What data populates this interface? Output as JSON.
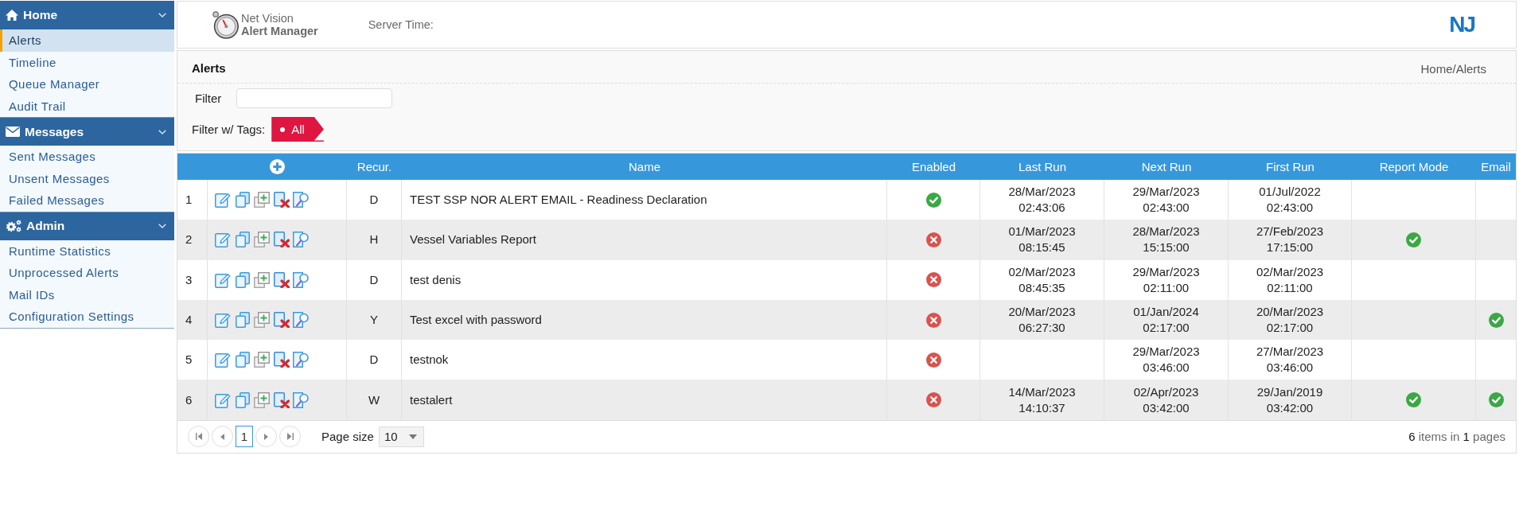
{
  "sidebar": {
    "sections": [
      {
        "title": "Home",
        "expanded": true,
        "items": [
          {
            "label": "Alerts",
            "selected": true
          },
          {
            "label": "Timeline",
            "selected": false
          },
          {
            "label": "Queue Manager",
            "selected": false
          },
          {
            "label": "Audit Trail",
            "selected": false
          }
        ]
      },
      {
        "title": "Messages",
        "expanded": true,
        "items": [
          {
            "label": "Sent Messages",
            "selected": false
          },
          {
            "label": "Unsent Messages",
            "selected": false
          },
          {
            "label": "Failed Messages",
            "selected": false
          }
        ]
      },
      {
        "title": "Admin",
        "expanded": true,
        "items": [
          {
            "label": "Runtime Statistics",
            "selected": false
          },
          {
            "label": "Unprocessed Alerts",
            "selected": false
          },
          {
            "label": "Mail IDs",
            "selected": false
          },
          {
            "label": "Configuration Settings",
            "selected": false
          }
        ]
      }
    ]
  },
  "header": {
    "app_name": "Net Vision",
    "app_subtitle": "Alert Manager",
    "server_time_label": "Server Time:",
    "brand_logo": "NJ"
  },
  "page": {
    "title": "Alerts",
    "breadcrumb": "Home/Alerts",
    "filter": {
      "label": "Filter"
    },
    "tag_filter": {
      "label": "Filter w/ Tags:",
      "tags": [
        {
          "label": "All",
          "selected": true
        }
      ]
    }
  },
  "table": {
    "columns": [
      "Recur.",
      "Name",
      "Enabled",
      "Last Run",
      "Next Run",
      "First Run",
      "Report Mode",
      "Email"
    ],
    "rows": [
      {
        "number": "1",
        "recurrence": "D",
        "name": "TEST SSP NOR ALERT EMAIL - Readiness Declaration",
        "enabled": true,
        "last_run": {
          "date": "28/Mar/2023",
          "time": "02:43:06"
        },
        "next_run": {
          "date": "29/Mar/2023",
          "time": "02:43:00"
        },
        "first_run": {
          "date": "01/Jul/2022",
          "time": "02:43:00"
        },
        "report_mode": false,
        "email": false
      },
      {
        "number": "2",
        "recurrence": "H",
        "name": "Vessel Variables Report",
        "enabled": false,
        "last_run": {
          "date": "01/Mar/2023",
          "time": "08:15:45"
        },
        "next_run": {
          "date": "28/Mar/2023",
          "time": "15:15:00"
        },
        "first_run": {
          "date": "27/Feb/2023",
          "time": "17:15:00"
        },
        "report_mode": true,
        "email": false
      },
      {
        "number": "3",
        "recurrence": "D",
        "name": "test denis",
        "enabled": false,
        "last_run": {
          "date": "02/Mar/2023",
          "time": "08:45:35"
        },
        "next_run": {
          "date": "29/Mar/2023",
          "time": "02:11:00"
        },
        "first_run": {
          "date": "02/Mar/2023",
          "time": "02:11:00"
        },
        "report_mode": false,
        "email": false
      },
      {
        "number": "4",
        "recurrence": "Y",
        "name": "Test excel with password",
        "enabled": false,
        "last_run": {
          "date": "20/Mar/2023",
          "time": "06:27:30"
        },
        "next_run": {
          "date": "01/Jan/2024",
          "time": "02:17:00"
        },
        "first_run": {
          "date": "20/Mar/2023",
          "time": "02:17:00"
        },
        "report_mode": false,
        "email": true
      },
      {
        "number": "5",
        "recurrence": "D",
        "name": "testnok",
        "enabled": false,
        "next_run": {
          "date": "29/Mar/2023",
          "time": "03:46:00"
        },
        "first_run": {
          "date": "27/Mar/2023",
          "time": "03:46:00"
        },
        "report_mode": false,
        "email": false
      },
      {
        "number": "6",
        "recurrence": "W",
        "name": "testalert",
        "enabled": false,
        "last_run": {
          "date": "14/Mar/2023",
          "time": "14:10:37"
        },
        "next_run": {
          "date": "02/Apr/2023",
          "time": "03:42:00"
        },
        "first_run": {
          "date": "29/Jan/2019",
          "time": "03:42:00"
        },
        "report_mode": true,
        "email": true
      }
    ]
  },
  "pager": {
    "pages": [
      {
        "label": "1",
        "selected": true
      }
    ],
    "page_size_label": "Page size",
    "page_size": "10",
    "summary": "**6** items in **1** pages"
  }
}
